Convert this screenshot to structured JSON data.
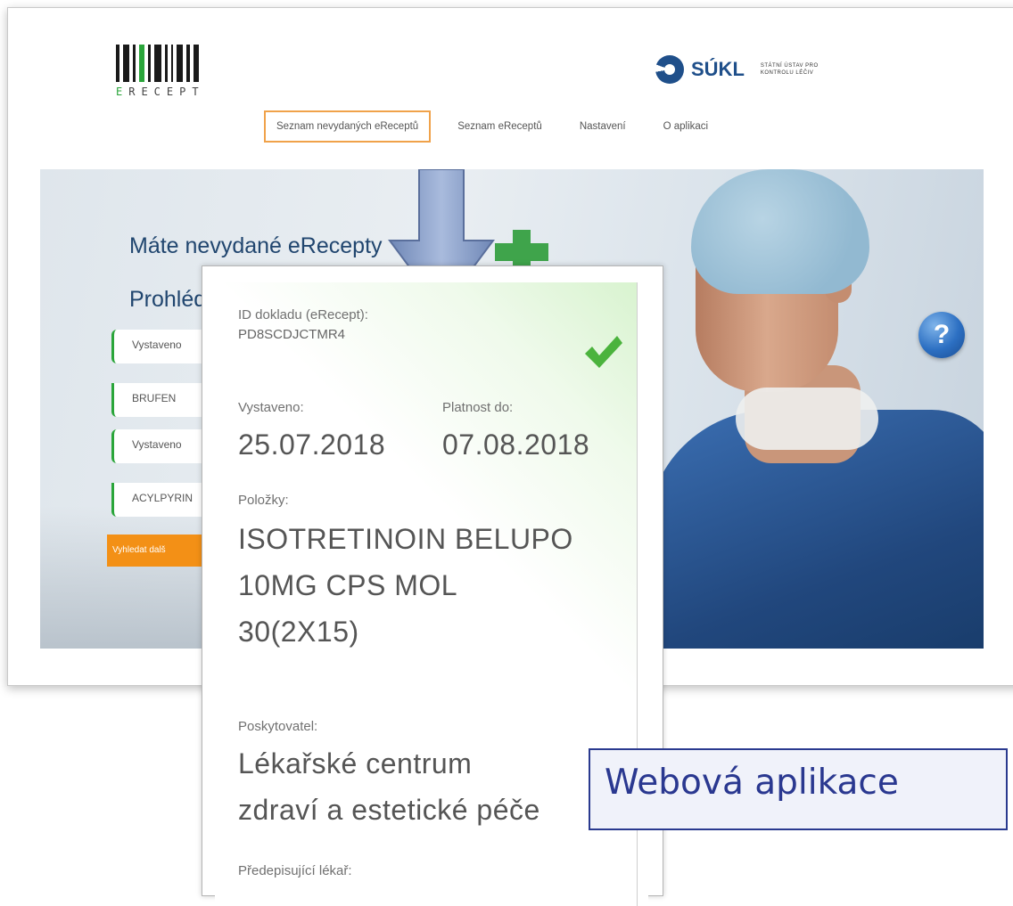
{
  "header": {
    "logo_word": "ERECEPT",
    "logo_first_letter": "E",
    "logo_rest": "RECEPT",
    "sukl_name": "SÚKL",
    "sukl_subtitle": "STÁTNÍ ÚSTAV PRO KONTROLU LÉČIV"
  },
  "nav": {
    "tabs": [
      {
        "label": "Seznam nevydaných eReceptů",
        "active": true
      },
      {
        "label": "Seznam eReceptů",
        "active": false
      },
      {
        "label": "Nastavení",
        "active": false
      },
      {
        "label": "O aplikaci",
        "active": false
      }
    ]
  },
  "hero": {
    "title": "Máte nevydané eRecepty",
    "subtitle": "Prohlédněte si je",
    "cards": [
      {
        "line1": "Vystaveno",
        "line2": "BRUFEN"
      },
      {
        "line1": "Vystaveno",
        "line2": "ACYLPYRIN"
      }
    ],
    "search_button": "Vyhledat dalš"
  },
  "popup": {
    "id_label": "ID dokladu (eRecept):",
    "id_value": "PD8SCDJCTMR4",
    "issued_label": "Vystaveno:",
    "issued_value": "25.07.2018",
    "valid_label": "Platnost do:",
    "valid_value": "07.08.2018",
    "items_label": "Položky:",
    "item_lines": [
      "ISOTRETINOIN BELUPO",
      "10MG CPS MOL",
      "30(2X15)"
    ],
    "provider_label": "Poskytovatel:",
    "provider_lines": [
      "Lékařské centrum",
      "zdraví a estetické péče"
    ],
    "doctor_label": "Předepisující lékař:"
  },
  "overlay_label": "Webová aplikace",
  "colors": {
    "accent_orange": "#f39016",
    "accent_green": "#2aa53a",
    "brand_blue": "#1f4f8a",
    "label_blue": "#2a3890"
  }
}
